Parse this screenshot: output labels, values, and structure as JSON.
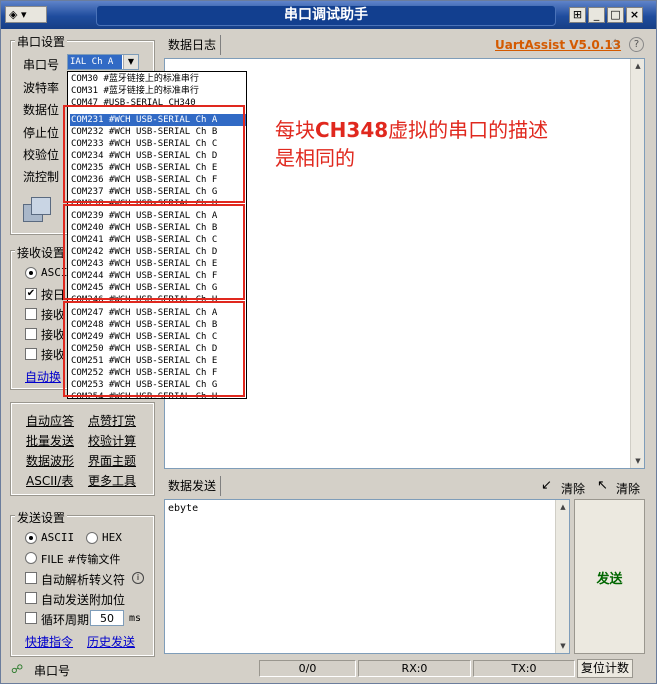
{
  "window": {
    "title": "串口调试助手",
    "sys_menu_label": "◈ ▾"
  },
  "header": {
    "brand": "UartAssist V5.0.13"
  },
  "serial_settings": {
    "group_label": "串口设置",
    "port_label": "串口号",
    "port_value": "IAL Ch A",
    "baud_label": "波特率",
    "data_bits_label": "数据位",
    "stop_bits_label": "停止位",
    "parity_label": "校验位",
    "flow_label": "流控制"
  },
  "port_dropdown": {
    "items": [
      "COM30 #蓝牙链接上的标准串行",
      "COM31 #蓝牙链接上的标准串行",
      "COM47 #USB-SERIAL CH340",
      "COM231 #WCH USB-SERIAL Ch A",
      "COM232 #WCH USB-SERIAL Ch B",
      "COM233 #WCH USB-SERIAL Ch C",
      "COM234 #WCH USB-SERIAL Ch D",
      "COM235 #WCH USB-SERIAL Ch E",
      "COM236 #WCH USB-SERIAL Ch F",
      "COM237 #WCH USB-SERIAL Ch G",
      "COM238 #WCH USB-SERIAL Ch H",
      "COM239 #WCH USB-SERIAL Ch A",
      "COM240 #WCH USB-SERIAL Ch B",
      "COM241 #WCH USB-SERIAL Ch C",
      "COM242 #WCH USB-SERIAL Ch D",
      "COM243 #WCH USB-SERIAL Ch E",
      "COM244 #WCH USB-SERIAL Ch F",
      "COM245 #WCH USB-SERIAL Ch G",
      "COM246 #WCH USB-SERIAL Ch H",
      "COM247 #WCH USB-SERIAL Ch A",
      "COM248 #WCH USB-SERIAL Ch B",
      "COM249 #WCH USB-SERIAL Ch C",
      "COM250 #WCH USB-SERIAL Ch D",
      "COM251 #WCH USB-SERIAL Ch E",
      "COM252 #WCH USB-SERIAL Ch F",
      "COM253 #WCH USB-SERIAL Ch G",
      "COM254 #WCH USB-SERIAL Ch H"
    ],
    "selected_index": 3
  },
  "annotation": {
    "line1_prefix": "每块",
    "line1_bold": "CH348",
    "line1_suffix": "虚拟的串口的描述",
    "line2": "是相同的",
    "color": "#e0281e"
  },
  "receive_settings": {
    "group_label": "接收设置",
    "ascii_label": "ASCII",
    "opt1": "按日",
    "opt2": "接收",
    "opt3": "接收",
    "opt4": "接收",
    "auto_link": "自动换"
  },
  "tools": {
    "auto_reply": "自动应答",
    "tips": "点赞打赏",
    "batch_send": "批量发送",
    "checksum": "校验计算",
    "waveform": "数据波形",
    "theme": "界面主题",
    "ascii_table": "ASCII/表",
    "more_tools": "更多工具"
  },
  "send_settings": {
    "group_label": "发送设置",
    "ascii_label": "ASCII",
    "hex_label": "HEX",
    "file_label": "FILE #传输文件",
    "auto_escape_label": "自动解析转义符",
    "auto_append_label": "自动发送附加位",
    "loop_label": "循环周期",
    "loop_value": "50",
    "loop_unit": "ms",
    "shortcut_link": "快捷指令",
    "history_link": "历史发送"
  },
  "log": {
    "tab_label": "数据日志"
  },
  "send_panel": {
    "tab_label": "数据发送",
    "clear1": "清除",
    "clear2": "清除",
    "text": "ebyte",
    "send_label": "发送"
  },
  "status": {
    "port_label": "串口号",
    "count": "0/0",
    "rx": "RX:0",
    "tx": "TX:0",
    "reset_label": "复位计数"
  },
  "colors": {
    "brand": "#d45a00",
    "send": "#006600",
    "link": "#0000cc"
  }
}
